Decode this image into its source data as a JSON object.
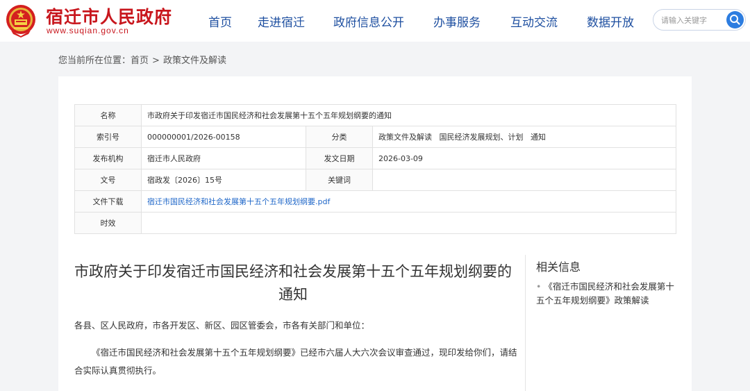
{
  "header": {
    "site_title": "宿迁市人民政府",
    "site_domain": "www.suqian.gov.cn",
    "nav": [
      "首页",
      "走进宿迁",
      "政府信息公开",
      "办事服务",
      "互动交流",
      "数据开放"
    ],
    "search_placeholder": "请输入关键字",
    "emblem_icon": "national-emblem-icon",
    "search_icon": "search-icon"
  },
  "breadcrumb": {
    "prefix": "您当前所在位置：",
    "items": [
      "首页",
      "政策文件及解读"
    ],
    "separator": ">"
  },
  "meta": {
    "name_label": "名称",
    "name_value": "市政府关于印发宿迁市国民经济和社会发展第十五个五年规划纲要的通知",
    "index_label": "索引号",
    "index_value": "000000001/2026-00158",
    "category_label": "分类",
    "category_value": "政策文件及解读   国民经济发展规划、计划   通知",
    "issuer_label": "发布机构",
    "issuer_value": "宿迁市人民政府",
    "date_label": "发文日期",
    "date_value": "2026-03-09",
    "docno_label": "文号",
    "docno_value": "宿政发〔2026〕15号",
    "keyword_label": "关键词",
    "keyword_value": "",
    "download_label": "文件下载",
    "download_value": "宿迁市国民经济和社会发展第十五个五年规划纲要.pdf",
    "validity_label": "时效",
    "validity_value": ""
  },
  "article": {
    "title": "市政府关于印发宿迁市国民经济和社会发展第十五个五年规划纲要的通知",
    "recipients": "各县、区人民政府，市各开发区、新区、园区管委会，市各有关部门和单位：",
    "body": "《宿迁市国民经济和社会发展第十五个五年规划纲要》已经市六届人大六次会议审查通过，现印发给你们，请结合实际认真贯彻执行。"
  },
  "related": {
    "title": "相关信息",
    "items": [
      "《宿迁市国民经济和社会发展第十五个五年规划纲要》政策解读"
    ]
  },
  "colors": {
    "brand_red": "#c8161d",
    "nav_blue": "#1e4fa0",
    "link_blue": "#1e66c8",
    "search_blue": "#2d7de0"
  }
}
